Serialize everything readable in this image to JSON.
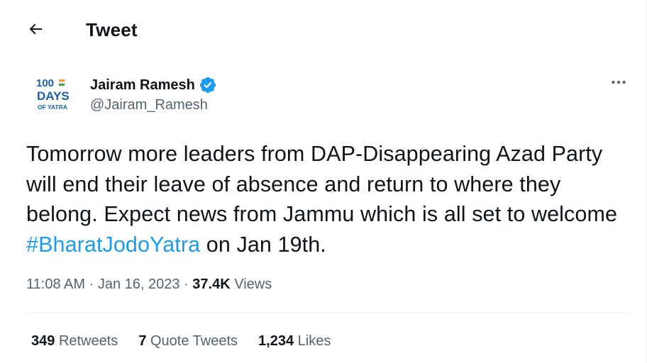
{
  "header": {
    "title": "Tweet",
    "back_icon": "arrow-left-icon"
  },
  "author": {
    "avatar_text": [
      "100",
      "DAYS",
      "OF YATRA"
    ],
    "display_name": "Jairam Ramesh",
    "handle": "@Jairam_Ramesh",
    "verified": true,
    "verified_icon": "verified-badge-icon",
    "more_icon": "more-horizontal-icon"
  },
  "tweet": {
    "text_before": "Tomorrow more leaders from DAP-Disappearing Azad Party will end their leave of absence and return to where they belong. Expect news from Jammu which is all set to welcome ",
    "hashtag": "#BharatJodoYatra",
    "text_after": " on Jan 19th."
  },
  "meta": {
    "time": "11:08 AM",
    "separator": "·",
    "date": "Jan 16, 2023",
    "views_count": "37.4K",
    "views_label": "Views"
  },
  "stats": {
    "retweets_count": "349",
    "retweets_label": "Retweets",
    "quotes_count": "7",
    "quotes_label": "Quote Tweets",
    "likes_count": "1,234",
    "likes_label": "Likes"
  },
  "colors": {
    "text_primary": "#0f1419",
    "text_secondary": "#536471",
    "accent": "#1d9bf0",
    "divider": "#eff3f4",
    "avatar_blue": "#1a5fa8"
  }
}
